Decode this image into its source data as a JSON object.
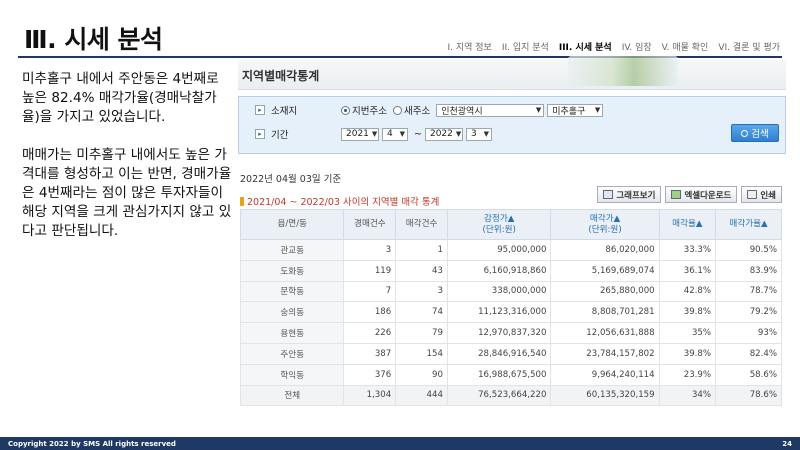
{
  "slide": {
    "title": "Ⅲ. 시세 분석",
    "toc": [
      "I. 지역 정보",
      "II. 입지 분석",
      "III. 시세 분석",
      "IV. 임장",
      "V. 매물 확인",
      "VI. 결론 및 평가"
    ],
    "toc_active_index": 2,
    "body_paragraphs": [
      "미추홀구 내에서 주안동은 4번째로 높은 82.4% 매각가율(경매낙찰가율)을 가지고 있었습니다.",
      "매매가는 미추홀구 내에서도 높은 가격대를 형성하고 이는 반면, 경매가율은 4번째라는 점이 많은 투자자들이 해당 지역을 크게 관심가지지 않고 있다고 판단됩니다."
    ],
    "footer_left": "Copyright 2022 by SMS All rights reserved",
    "page_number": "24",
    "accent_color": "#1f3864"
  },
  "panel": {
    "title": "지역별매각통계",
    "search": {
      "location_label": "소재지",
      "radio_lot": "지번주소",
      "radio_road": "새주소",
      "city": "인천광역시",
      "district": "미추홀구",
      "period_label": "기간",
      "from_year": "2021",
      "from_month": "4",
      "tilde": "~",
      "to_year": "2022",
      "to_month": "3",
      "search_button": "검색"
    },
    "date_ref": "2022년 04월 03일 기준",
    "period_title": "2021/04 ~ 2022/03 사이의 지역별 매각 통계",
    "buttons": {
      "graph": "그래프보기",
      "excel": "엑셀다운로드",
      "print": "인쇄"
    },
    "table": {
      "headers": [
        {
          "label": "읍/면/동",
          "sub": ""
        },
        {
          "label": "경매건수",
          "sub": ""
        },
        {
          "label": "매각건수",
          "sub": ""
        },
        {
          "label": "감정가▲",
          "sub": "(단위:원)"
        },
        {
          "label": "매각가▲",
          "sub": "(단위:원)"
        },
        {
          "label": "매각율▲",
          "sub": ""
        },
        {
          "label": "매각가율▲",
          "sub": ""
        }
      ],
      "rows": [
        {
          "name": "관교동",
          "auctions": "3",
          "sold": "1",
          "appraisal": "95,000,000",
          "sale_price": "86,020,000",
          "sale_rate": "33.3%",
          "price_rate": "90.5%"
        },
        {
          "name": "도화동",
          "auctions": "119",
          "sold": "43",
          "appraisal": "6,160,918,860",
          "sale_price": "5,169,689,074",
          "sale_rate": "36.1%",
          "price_rate": "83.9%"
        },
        {
          "name": "문학동",
          "auctions": "7",
          "sold": "3",
          "appraisal": "338,000,000",
          "sale_price": "265,880,000",
          "sale_rate": "42.8%",
          "price_rate": "78.7%"
        },
        {
          "name": "숭의동",
          "auctions": "186",
          "sold": "74",
          "appraisal": "11,123,316,000",
          "sale_price": "8,808,701,281",
          "sale_rate": "39.8%",
          "price_rate": "79.2%"
        },
        {
          "name": "용현동",
          "auctions": "226",
          "sold": "79",
          "appraisal": "12,970,837,320",
          "sale_price": "12,056,631,888",
          "sale_rate": "35%",
          "price_rate": "93%"
        },
        {
          "name": "주안동",
          "auctions": "387",
          "sold": "154",
          "appraisal": "28,846,916,540",
          "sale_price": "23,784,157,802",
          "sale_rate": "39.8%",
          "price_rate": "82.4%"
        },
        {
          "name": "학익동",
          "auctions": "376",
          "sold": "90",
          "appraisal": "16,988,675,500",
          "sale_price": "9,964,240,114",
          "sale_rate": "23.9%",
          "price_rate": "58.6%"
        }
      ],
      "total": {
        "name": "전체",
        "auctions": "1,304",
        "sold": "444",
        "appraisal": "76,523,664,220",
        "sale_price": "60,135,320,159",
        "sale_rate": "34%",
        "price_rate": "78.6%"
      }
    }
  }
}
